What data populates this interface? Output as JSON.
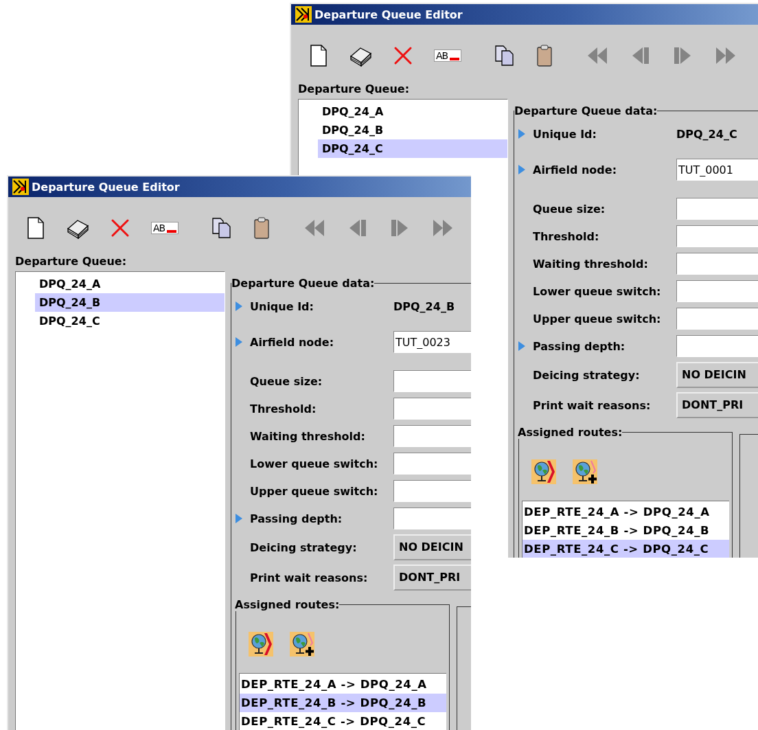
{
  "windows": [
    {
      "title": "Departure Queue Editor",
      "toolbar": [
        {
          "kind": "new",
          "disabled": false
        },
        {
          "kind": "eraser",
          "disabled": false
        },
        {
          "kind": "delete",
          "disabled": false
        },
        {
          "kind": "rename",
          "label": "AB",
          "disabled": false
        },
        {
          "kind": "copy",
          "disabled": false
        },
        {
          "kind": "paste",
          "disabled": false
        },
        {
          "kind": "first",
          "disabled": true
        },
        {
          "kind": "prev",
          "disabled": true
        },
        {
          "kind": "next",
          "disabled": true
        },
        {
          "kind": "last",
          "disabled": true
        }
      ],
      "list_label": "Departure Queue:",
      "queues": [
        {
          "label": "DPQ_24_A",
          "selected": false
        },
        {
          "label": "DPQ_24_B",
          "selected": false
        },
        {
          "label": "DPQ_24_C",
          "selected": true
        }
      ],
      "group_title": "Departure Queue data:",
      "fields": [
        {
          "kind": "text",
          "label": "Unique Id:",
          "value": "DPQ_24_C",
          "required": true
        },
        {
          "kind": "input",
          "label": "Airfield node:",
          "value": "TUT_0001",
          "required": true
        },
        {
          "kind": "input",
          "label": "Queue size:",
          "required": false
        },
        {
          "kind": "input",
          "label": "Threshold:",
          "required": false
        },
        {
          "kind": "input",
          "label": "Waiting threshold:",
          "required": false
        },
        {
          "kind": "input",
          "label": "Lower queue switch:",
          "required": false
        },
        {
          "kind": "input",
          "label": "Upper queue switch:",
          "required": false
        },
        {
          "kind": "input",
          "label": "Passing depth:",
          "required": true
        },
        {
          "kind": "combo",
          "label": "Deicing strategy:",
          "value": "NO DEICIN",
          "required": false
        },
        {
          "kind": "combo",
          "label": "Print wait reasons:",
          "value": "DONT_PRI",
          "required": false
        }
      ],
      "routes_title": "Assigned routes:",
      "routes": [
        {
          "label": "DEP_RTE_24_A -> DPQ_24_A",
          "selected": false
        },
        {
          "label": "DEP_RTE_24_B -> DPQ_24_B",
          "selected": false
        },
        {
          "label": "DEP_RTE_24_C -> DPQ_24_C",
          "selected": true
        }
      ]
    },
    {
      "title": "Departure Queue Editor",
      "toolbar": [
        {
          "kind": "new",
          "disabled": false
        },
        {
          "kind": "eraser",
          "disabled": false
        },
        {
          "kind": "delete",
          "disabled": false
        },
        {
          "kind": "rename",
          "label": "AB",
          "disabled": false
        },
        {
          "kind": "copy",
          "disabled": false
        },
        {
          "kind": "paste",
          "disabled": false
        },
        {
          "kind": "first",
          "disabled": true
        },
        {
          "kind": "prev",
          "disabled": true
        },
        {
          "kind": "next",
          "disabled": true
        },
        {
          "kind": "last",
          "disabled": true
        }
      ],
      "list_label": "Departure Queue:",
      "queues": [
        {
          "label": "DPQ_24_A",
          "selected": false
        },
        {
          "label": "DPQ_24_B",
          "selected": true
        },
        {
          "label": "DPQ_24_C",
          "selected": false
        }
      ],
      "group_title": "Departure Queue data:",
      "fields": [
        {
          "kind": "text",
          "label": "Unique Id:",
          "value": "DPQ_24_B",
          "required": true
        },
        {
          "kind": "input",
          "label": "Airfield node:",
          "value": "TUT_0023",
          "required": true
        },
        {
          "kind": "input",
          "label": "Queue size:",
          "required": false
        },
        {
          "kind": "input",
          "label": "Threshold:",
          "required": false
        },
        {
          "kind": "input",
          "label": "Waiting threshold:",
          "required": false
        },
        {
          "kind": "input",
          "label": "Lower queue switch:",
          "required": false
        },
        {
          "kind": "input",
          "label": "Upper queue switch:",
          "required": false
        },
        {
          "kind": "input",
          "label": "Passing depth:",
          "required": true
        },
        {
          "kind": "combo",
          "label": "Deicing strategy:",
          "value": "NO DEICIN",
          "required": false
        },
        {
          "kind": "combo",
          "label": "Print wait reasons:",
          "value": "DONT_PRI",
          "required": false
        }
      ],
      "routes_title": "Assigned routes:",
      "routes": [
        {
          "label": "DEP_RTE_24_A -> DPQ_24_A",
          "selected": false
        },
        {
          "label": "DEP_RTE_24_B -> DPQ_24_B",
          "selected": true
        },
        {
          "label": "DEP_RTE_24_C -> DPQ_24_C",
          "selected": false
        }
      ]
    }
  ]
}
